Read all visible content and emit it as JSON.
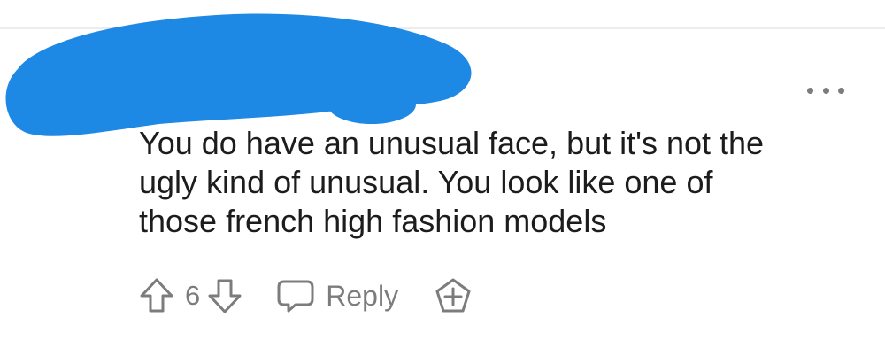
{
  "comment": {
    "body": "You do have an unusual face, but it's not the\nugly kind of unusual. You look like one of\nthose french high fashion models",
    "score": "6"
  },
  "actions": {
    "reply_label": "Reply"
  },
  "icons": {
    "upvote": "arrow-up-icon",
    "downvote": "arrow-down-icon",
    "reply": "speech-bubble-icon",
    "award": "award-plus-icon",
    "more": "more-dots-icon"
  },
  "colors": {
    "redaction": "#1e88e5",
    "icon_gray": "#7c7c7c",
    "text": "#1c1c1c"
  }
}
